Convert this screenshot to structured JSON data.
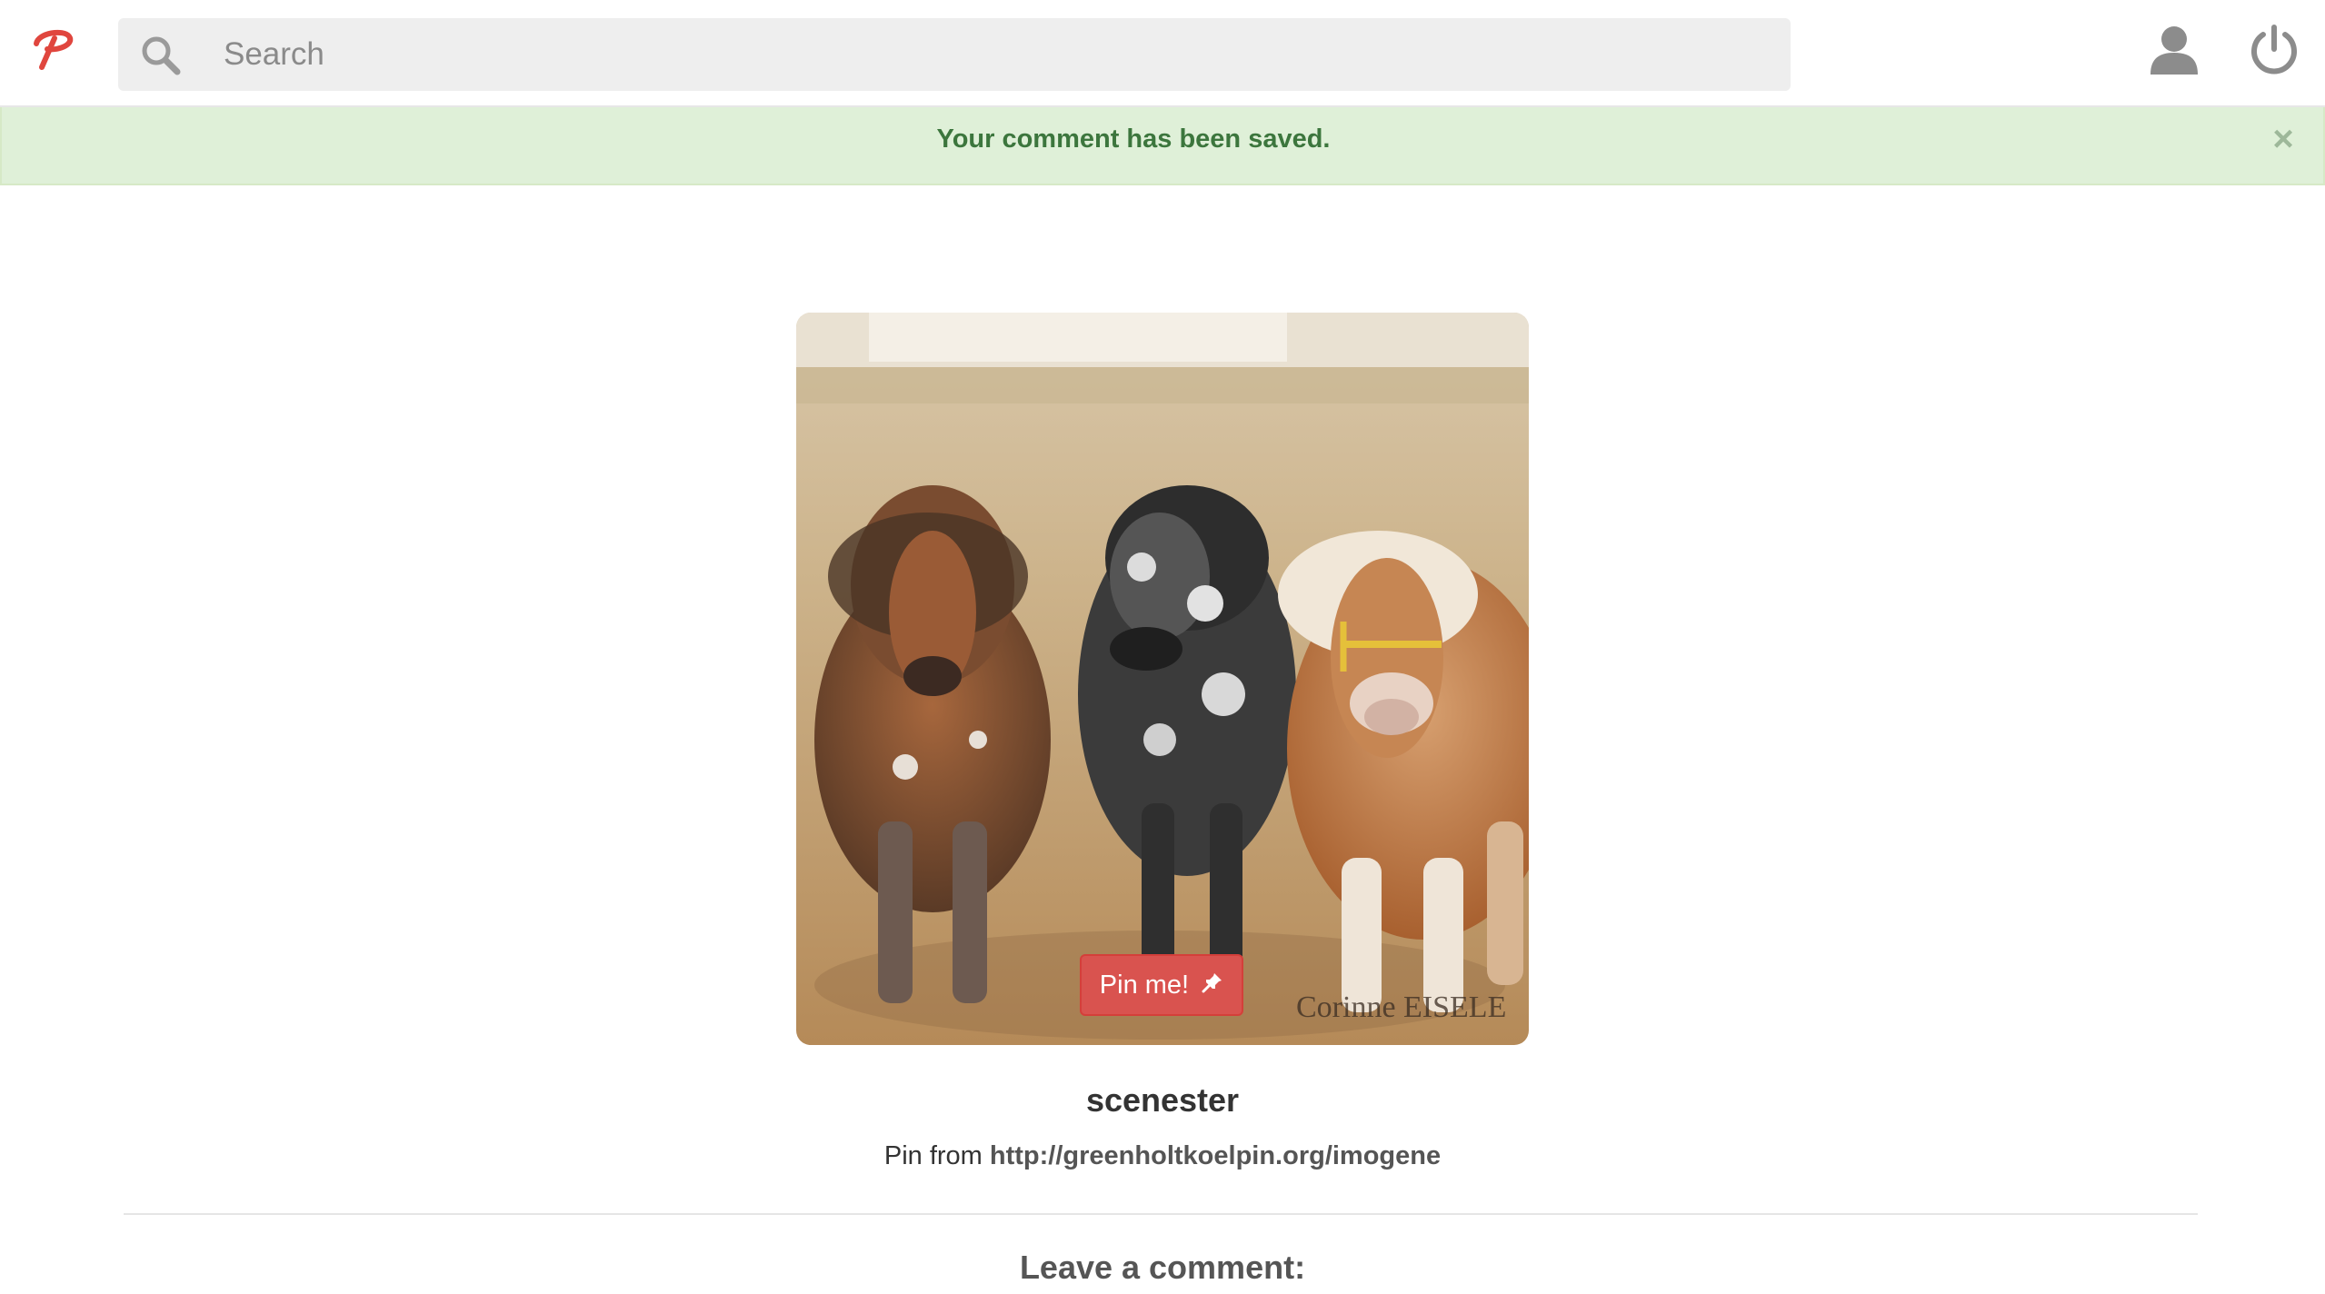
{
  "navbar": {
    "logo_icon": "pinry-logo",
    "search": {
      "placeholder": "Search",
      "value": ""
    },
    "user_icon": "user-icon",
    "logout_icon": "power-icon"
  },
  "alert": {
    "message": "Your comment has been saved.",
    "close_label": "×"
  },
  "pin": {
    "image_watermark": "Corinne EISELE",
    "pin_button_label": "Pin me!",
    "pin_button_icon": "pushpin-icon",
    "username": "scenester",
    "source_prefix": "Pin from",
    "source_url": "http://greenholtkoelpin.org/imogene"
  },
  "comments": {
    "heading": "Leave a comment:"
  },
  "colors": {
    "brand": "#d9534f",
    "alert_bg": "#dff0d8",
    "alert_text": "#3c763d"
  }
}
